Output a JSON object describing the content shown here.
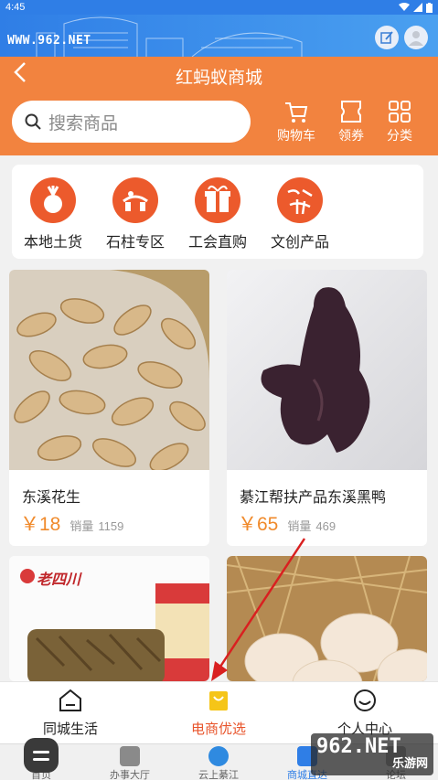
{
  "status_bar": {
    "time": "4:45"
  },
  "banner": {
    "brand": "WWW.962.NET"
  },
  "header": {
    "title": "红蚂蚁商城",
    "search_placeholder": "搜索商品",
    "buttons": [
      {
        "label": "购物车",
        "icon": "cart-icon"
      },
      {
        "label": "领券",
        "icon": "coupon-icon"
      },
      {
        "label": "分类",
        "icon": "grid-icon"
      }
    ]
  },
  "categories": [
    {
      "label": "本地土货",
      "icon": "vegetable-icon"
    },
    {
      "label": "石柱专区",
      "icon": "shizhu-icon"
    },
    {
      "label": "工会直购",
      "icon": "gift-icon"
    },
    {
      "label": "文创产品",
      "icon": "culture-icon"
    }
  ],
  "products": [
    {
      "name": "东溪花生",
      "price": "￥18",
      "sold_label": "销量",
      "sold": "1159"
    },
    {
      "name": "綦江帮扶产品东溪黑鸭",
      "price": "￥65",
      "sold_label": "销量",
      "sold": "469"
    },
    {
      "name": "",
      "price": "",
      "sold_label": "",
      "sold": "",
      "brand_text": "老四川"
    },
    {
      "name": "",
      "price": "",
      "sold_label": "",
      "sold": ""
    }
  ],
  "section_nav": [
    {
      "label": "同城生活",
      "icon": "home-icon"
    },
    {
      "label": "电商优选",
      "icon": "shopping-bag-icon",
      "active": true
    },
    {
      "label": "个人中心",
      "icon": "smile-icon"
    }
  ],
  "bottom_nav": [
    {
      "label": "首页",
      "icon": "home-icon"
    },
    {
      "label": "办事大厅",
      "icon": "service-icon"
    },
    {
      "label": "云上綦江",
      "icon": "cloud-icon"
    },
    {
      "label": "商城直达",
      "icon": "mall-icon",
      "active": true
    },
    {
      "label": "论坛",
      "icon": "forum-icon"
    }
  ],
  "watermark": {
    "main": "962.NET",
    "sub": "乐游网"
  },
  "colors": {
    "header": "#f2833f",
    "banner": "#2f7ee6",
    "price": "#f08a2b",
    "active": "#e8542b"
  }
}
